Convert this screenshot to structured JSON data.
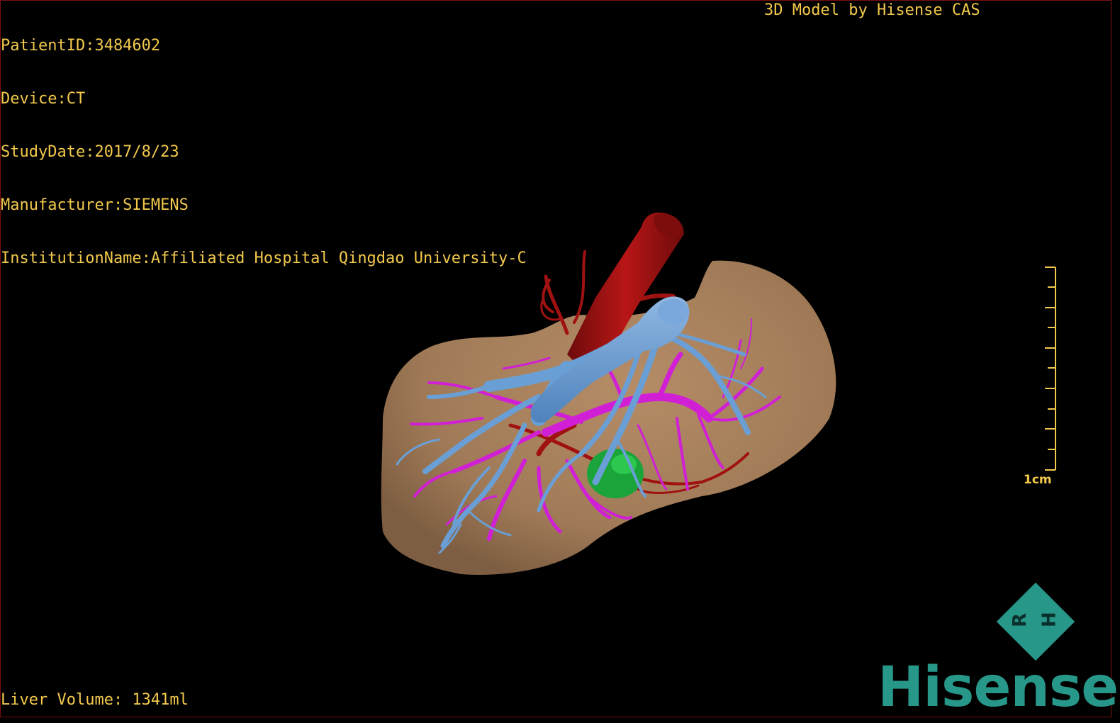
{
  "colors": {
    "overlay_text": "#f2c94c",
    "liver": "#a8805c",
    "portal_vein": "#d11fd6",
    "hepatic_vein": "#6a9fd6",
    "artery_ivc": "#a01212",
    "lesion": "#1aa43a",
    "brand_teal": "#27978a"
  },
  "header": {
    "patient_id": "PatientID:3484602",
    "device": "Device:CT",
    "study_date": "StudyDate:2017/8/23",
    "manufacturer": "Manufacturer:SIEMENS",
    "institution": "InstitutionName:Affiliated Hospital Qingdao University-C",
    "model_credit": "3D Model by Hisense CAS"
  },
  "footer": {
    "liver_volume": "Liver Volume: 1341ml"
  },
  "scale_bar": {
    "label": "1cm"
  },
  "orientation_marker": {
    "icon": "orientation-cube-icon",
    "letters": [
      "H",
      "R"
    ]
  },
  "logo": {
    "text": "Hisense"
  }
}
